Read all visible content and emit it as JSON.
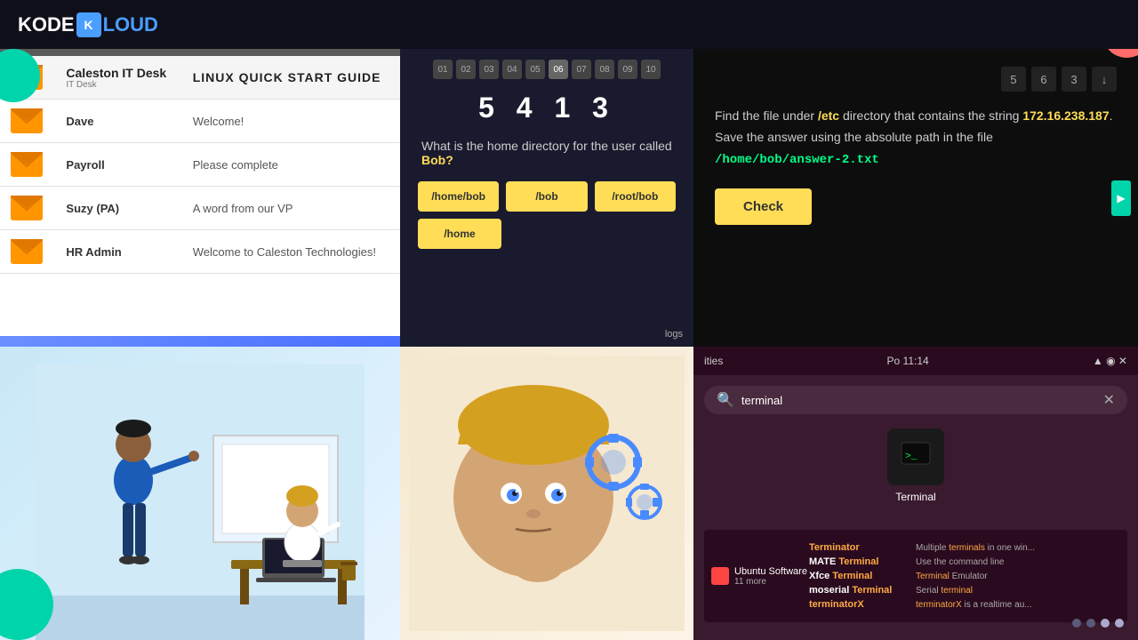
{
  "header": {
    "logo_text_1": "KODE",
    "logo_separator": "K",
    "logo_text_2": "LOUD"
  },
  "panel_email": {
    "title": "LINUX QUICK START GUIDE",
    "rows": [
      {
        "sender": "Caleston IT Desk",
        "subject": "LINUX QUICK START GUIDE",
        "is_header": true
      },
      {
        "sender": "Dave",
        "subject": "Welcome!"
      },
      {
        "sender": "Payroll",
        "subject": "Please complete"
      },
      {
        "sender": "Suzy (PA)",
        "subject": "A word from our VP"
      },
      {
        "sender": "HR Admin",
        "subject": "Welcome to Caleston Technologies!"
      }
    ]
  },
  "panel_quiz": {
    "progress_items": [
      "01",
      "02",
      "03",
      "04",
      "05",
      "06",
      "07",
      "08",
      "09",
      "10"
    ],
    "counter": "5 4 1 3",
    "question": "What is the home directory for the user called Bob?",
    "highlight_word": "Bob?",
    "options": [
      "/home/bob",
      "/bob",
      "/root/bob",
      "/home"
    ]
  },
  "panel_terminal": {
    "counter_items": [
      "5",
      "6",
      "3",
      "↓"
    ],
    "text_line1": "Find the file under ",
    "hl_etc": "/etc",
    "text_line2": " directory that contains the string",
    "hl_ip": "172.16.238.187",
    "text_line3": ". Save the answer using the absolute path in the file ",
    "hl_path": "/home/bob/answer-2.txt",
    "check_label": "Check"
  },
  "panel_ubuntu": {
    "titlebar": {
      "left_text": "ities",
      "center_text": "Po 11:14",
      "right_icons": "▲ ● ◉ ✕"
    },
    "search_placeholder": "terminal",
    "terminal_app_label": "Terminal",
    "apps_list": [
      {
        "source": "Ubuntu Software",
        "source_sub": "11 more",
        "items": [
          {
            "name": "Terminator",
            "desc": "Multiple terminals in one win..."
          },
          {
            "name": "MATE Terminal",
            "desc": "Use the command line"
          },
          {
            "name": "Xfce Terminal",
            "desc": "Terminal Emulator"
          },
          {
            "name": "moserial Terminal",
            "desc": "Serial terminal"
          },
          {
            "name": "terminatorX",
            "desc": "terminatorX is a realtime au..."
          }
        ]
      }
    ],
    "dots": [
      false,
      false,
      true,
      true
    ]
  }
}
